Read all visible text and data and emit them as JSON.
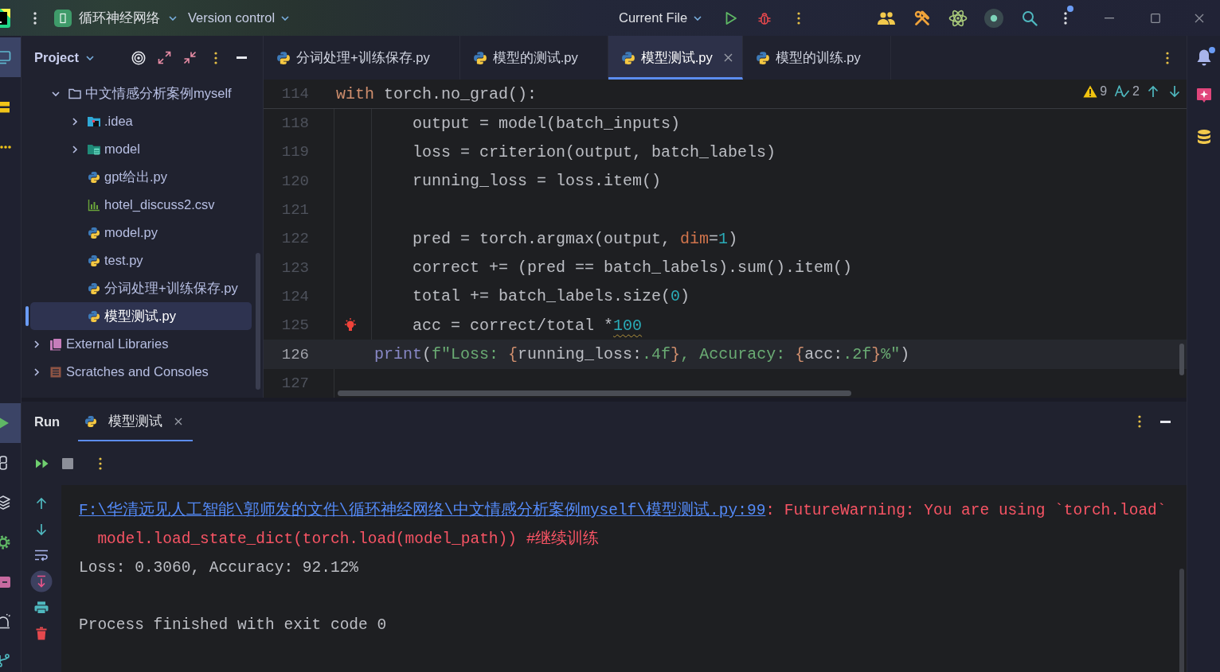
{
  "titlebar": {
    "project": "循环神经网络",
    "vcs": "Version control",
    "run_config": "Current File",
    "more_badge": true
  },
  "left_toolbar": {
    "top": [
      {
        "kind": "project",
        "selected": true
      },
      {
        "kind": "structure",
        "selected": false
      },
      {
        "kind": "more",
        "selected": false
      }
    ],
    "bottom": [
      {
        "kind": "run",
        "selected": true
      },
      {
        "kind": "console",
        "selected": false
      },
      {
        "kind": "layers",
        "selected": false
      },
      {
        "kind": "services",
        "selected": false
      },
      {
        "kind": "terminal",
        "selected": false
      },
      {
        "kind": "problems",
        "selected": false
      },
      {
        "kind": "git",
        "selected": false
      }
    ]
  },
  "project_panel": {
    "title": "Project",
    "tree": [
      {
        "label": "中文情感分析案例myself",
        "kind": "folder",
        "expanded": true,
        "selected": false,
        "children": [
          {
            "label": ".idea",
            "kind": "idea",
            "expanded": false,
            "selected": false
          },
          {
            "label": "model",
            "kind": "module",
            "expanded": false,
            "selected": false
          },
          {
            "label": "gpt给出.py",
            "kind": "python",
            "selected": false
          },
          {
            "label": "hotel_discuss2.csv",
            "kind": "csv",
            "selected": false
          },
          {
            "label": "model.py",
            "kind": "python",
            "selected": false
          },
          {
            "label": "test.py",
            "kind": "python",
            "selected": false
          },
          {
            "label": "分词处理+训练保存.py",
            "kind": "python",
            "selected": false
          },
          {
            "label": "模型测试.py",
            "kind": "python",
            "selected": true
          }
        ]
      },
      {
        "label": "External Libraries",
        "kind": "libraries",
        "expanded": false,
        "selected": false
      },
      {
        "label": "Scratches and Consoles",
        "kind": "scratches",
        "expanded": false,
        "selected": false
      }
    ]
  },
  "editor": {
    "tabs": [
      {
        "label": "分词处理+训练保存.py",
        "selected": false
      },
      {
        "label": "模型的测试.py",
        "selected": false
      },
      {
        "label": "模型测试.py",
        "selected": true
      },
      {
        "label": "模型的训练.py",
        "selected": false
      }
    ],
    "inspections": {
      "warnings": "9",
      "typos": "2"
    },
    "sticky_line": {
      "number": "114",
      "tokens": [
        {
          "text": "with",
          "kind": "keyword"
        },
        {
          "text": " torch.no_grad():",
          "kind": "plain"
        }
      ]
    },
    "lines": [
      {
        "number": "118",
        "current": false,
        "bulb": false,
        "tokens": [
          {
            "text": "        output = model(batch_inputs)",
            "kind": "plain"
          }
        ]
      },
      {
        "number": "119",
        "current": false,
        "bulb": false,
        "tokens": [
          {
            "text": "        loss = criterion(output, batch_labels)",
            "kind": "plain"
          }
        ]
      },
      {
        "number": "120",
        "current": false,
        "bulb": false,
        "tokens": [
          {
            "text": "        running_loss = loss.item()",
            "kind": "plain"
          }
        ]
      },
      {
        "number": "121",
        "current": false,
        "bulb": false
      },
      {
        "number": "122",
        "current": false,
        "bulb": false,
        "tokens": [
          {
            "text": "        pred = torch.argmax(output, ",
            "kind": "plain"
          },
          {
            "text": "dim",
            "kind": "param"
          },
          {
            "text": "=",
            "kind": "plain"
          },
          {
            "text": "1",
            "kind": "number"
          },
          {
            "text": ")",
            "kind": "plain"
          }
        ]
      },
      {
        "number": "123",
        "current": false,
        "bulb": false,
        "tokens": [
          {
            "text": "        correct += (pred == batch_labels).sum().item()",
            "kind": "plain"
          }
        ]
      },
      {
        "number": "124",
        "current": false,
        "bulb": false,
        "tokens": [
          {
            "text": "        total += batch_labels.size(",
            "kind": "plain"
          },
          {
            "text": "0",
            "kind": "number"
          },
          {
            "text": ")",
            "kind": "plain"
          }
        ]
      },
      {
        "number": "125",
        "current": false,
        "bulb": true,
        "tokens": [
          {
            "text": "        acc = correct/total *",
            "kind": "plain"
          },
          {
            "text": "100",
            "kind": "flagged"
          }
        ]
      },
      {
        "number": "126",
        "current": true,
        "bulb": false,
        "tokens": [
          {
            "text": "    print",
            "kind": "builtin"
          },
          {
            "text": "(",
            "kind": "plain"
          },
          {
            "text": "f\"Loss: ",
            "kind": "string"
          },
          {
            "text": "{",
            "kind": "brace"
          },
          {
            "text": "running_loss:",
            "kind": "plain"
          },
          {
            "text": ".4f",
            "kind": "string"
          },
          {
            "text": "}",
            "kind": "brace"
          },
          {
            "text": ", Accuracy: ",
            "kind": "string"
          },
          {
            "text": "{",
            "kind": "brace"
          },
          {
            "text": "acc:",
            "kind": "plain"
          },
          {
            "text": ".2f",
            "kind": "string"
          },
          {
            "text": "}",
            "kind": "brace"
          },
          {
            "text": "%\"",
            "kind": "string"
          },
          {
            "text": ")",
            "kind": "plain"
          }
        ]
      },
      {
        "number": "127",
        "current": false,
        "bulb": false
      }
    ]
  },
  "right_toolbar": [
    {
      "kind": "notifications",
      "unread": true
    },
    {
      "kind": "assistant"
    },
    {
      "kind": "database"
    }
  ],
  "run_panel": {
    "title": "Run",
    "tabs": [
      {
        "label": "模型测试",
        "selected": true
      }
    ],
    "console_tools": [
      {
        "kind": "up",
        "on": false
      },
      {
        "kind": "down",
        "on": false
      },
      {
        "kind": "wrap",
        "on": false
      },
      {
        "kind": "scrollend",
        "on": true
      },
      {
        "kind": "print",
        "on": false
      },
      {
        "kind": "clear",
        "on": false
      }
    ],
    "console": [
      {
        "kind": "error",
        "link": "F:\\华清远见人工智能\\郭师发的文件\\循环神经网络\\中文情感分析案例myself\\模型测试.py:99",
        "text": ": FutureWarning: You are using `torch.load`"
      },
      {
        "kind": "error",
        "text": "  model.load_state_dict(torch.load(model_path)) #继续训练"
      },
      {
        "kind": "output",
        "text": "Loss: 0.3060, Accuracy: 92.12%"
      },
      {
        "kind": "blank"
      },
      {
        "kind": "output",
        "text": "Process finished with exit code 0"
      }
    ]
  }
}
